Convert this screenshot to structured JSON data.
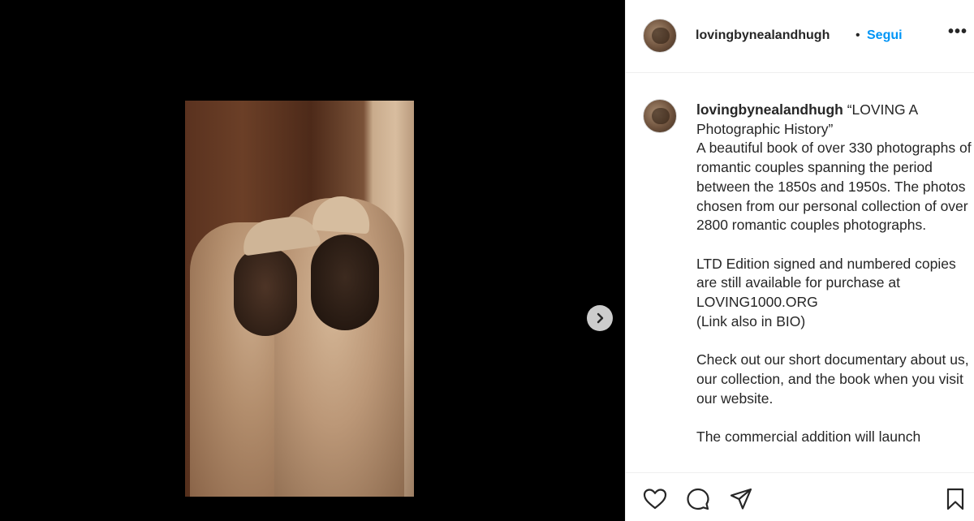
{
  "post": {
    "username": "lovingbynealandhugh",
    "separator": "•",
    "follow_label": "Segui",
    "more_label": "•••"
  },
  "caption": {
    "username": "lovingbynealandhugh",
    "text": " “LOVING A Photographic History”\nA beautiful book of over 330 photographs of romantic couples spanning the period between the 1850s and 1950s. The photos chosen from our personal collection of over 2800 romantic couples photographs.\n\nLTD Edition signed and numbered copies are still available for purchase at LOVING1000.ORG\n(Link also in BIO)\n\nCheck out our short documentary about us, our collection, and the book when you visit our website.\n\nThe commercial addition will launch"
  },
  "icons": {
    "next": "chevron-right-icon",
    "like": "heart-icon",
    "comment": "comment-bubble-icon",
    "share": "paper-plane-icon",
    "save": "bookmark-icon"
  },
  "colors": {
    "link_blue": "#0095f6",
    "text": "#262626",
    "border": "#efefef"
  }
}
